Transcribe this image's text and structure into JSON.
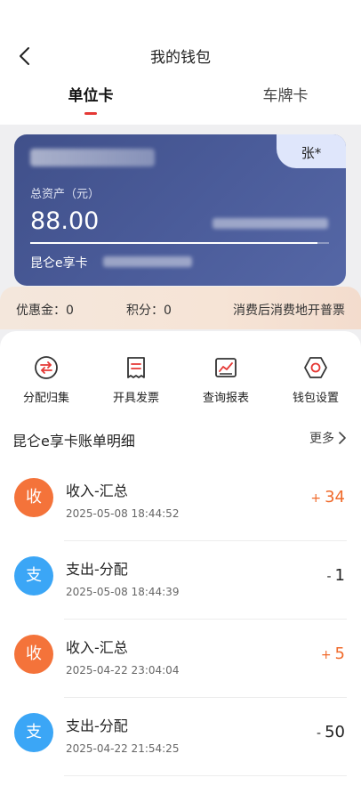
{
  "header": {
    "title": "我的钱包"
  },
  "tabs": [
    {
      "label": "单位卡"
    },
    {
      "label": "车牌卡"
    }
  ],
  "card": {
    "holder": "张*",
    "assets_label": "总资产（元）",
    "balance": "88.00",
    "card_name": "昆仑e享卡",
    "progress_fraction": 0.96
  },
  "info_bar": {
    "coupon": "优惠金：0",
    "points": "积分：0",
    "invoice_mode": "消费后消费地开普票"
  },
  "quick_actions": [
    {
      "label": "分配归集",
      "icon": "swap-icon"
    },
    {
      "label": "开具发票",
      "icon": "invoice-icon"
    },
    {
      "label": "查询报表",
      "icon": "chart-icon"
    },
    {
      "label": "钱包设置",
      "icon": "settings-icon"
    }
  ],
  "bills": {
    "title": "昆仑e享卡账单明细",
    "more_label": "更多",
    "items": [
      {
        "badge": "收",
        "type": "in",
        "title": "收入-汇总",
        "time": "2025-05-08 18:44:52",
        "sign": "+",
        "amount": "34"
      },
      {
        "badge": "支",
        "type": "out",
        "title": "支出-分配",
        "time": "2025-05-08 18:44:39",
        "sign": "-",
        "amount": "1"
      },
      {
        "badge": "收",
        "type": "in",
        "title": "收入-汇总",
        "time": "2025-04-22 23:04:04",
        "sign": "+",
        "amount": "5"
      },
      {
        "badge": "支",
        "type": "out",
        "title": "支出-分配",
        "time": "2025-04-22 21:54:25",
        "sign": "-",
        "amount": "50"
      }
    ]
  },
  "colors": {
    "accent_red": "#e53935",
    "income_orange": "#f4733a",
    "expense_blue": "#3ba6f6",
    "card_blue": "#4a5b99"
  }
}
